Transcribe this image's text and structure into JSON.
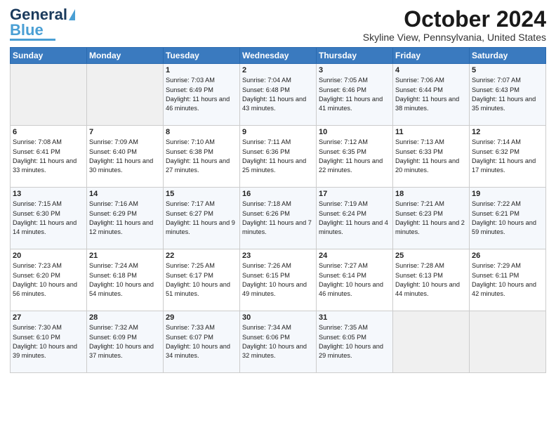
{
  "header": {
    "logo_line1": "General",
    "logo_line2": "Blue",
    "month": "October 2024",
    "location": "Skyline View, Pennsylvania, United States"
  },
  "weekdays": [
    "Sunday",
    "Monday",
    "Tuesday",
    "Wednesday",
    "Thursday",
    "Friday",
    "Saturday"
  ],
  "weeks": [
    [
      {
        "day": "",
        "sunrise": "",
        "sunset": "",
        "daylight": ""
      },
      {
        "day": "",
        "sunrise": "",
        "sunset": "",
        "daylight": ""
      },
      {
        "day": "1",
        "sunrise": "Sunrise: 7:03 AM",
        "sunset": "Sunset: 6:49 PM",
        "daylight": "Daylight: 11 hours and 46 minutes."
      },
      {
        "day": "2",
        "sunrise": "Sunrise: 7:04 AM",
        "sunset": "Sunset: 6:48 PM",
        "daylight": "Daylight: 11 hours and 43 minutes."
      },
      {
        "day": "3",
        "sunrise": "Sunrise: 7:05 AM",
        "sunset": "Sunset: 6:46 PM",
        "daylight": "Daylight: 11 hours and 41 minutes."
      },
      {
        "day": "4",
        "sunrise": "Sunrise: 7:06 AM",
        "sunset": "Sunset: 6:44 PM",
        "daylight": "Daylight: 11 hours and 38 minutes."
      },
      {
        "day": "5",
        "sunrise": "Sunrise: 7:07 AM",
        "sunset": "Sunset: 6:43 PM",
        "daylight": "Daylight: 11 hours and 35 minutes."
      }
    ],
    [
      {
        "day": "6",
        "sunrise": "Sunrise: 7:08 AM",
        "sunset": "Sunset: 6:41 PM",
        "daylight": "Daylight: 11 hours and 33 minutes."
      },
      {
        "day": "7",
        "sunrise": "Sunrise: 7:09 AM",
        "sunset": "Sunset: 6:40 PM",
        "daylight": "Daylight: 11 hours and 30 minutes."
      },
      {
        "day": "8",
        "sunrise": "Sunrise: 7:10 AM",
        "sunset": "Sunset: 6:38 PM",
        "daylight": "Daylight: 11 hours and 27 minutes."
      },
      {
        "day": "9",
        "sunrise": "Sunrise: 7:11 AM",
        "sunset": "Sunset: 6:36 PM",
        "daylight": "Daylight: 11 hours and 25 minutes."
      },
      {
        "day": "10",
        "sunrise": "Sunrise: 7:12 AM",
        "sunset": "Sunset: 6:35 PM",
        "daylight": "Daylight: 11 hours and 22 minutes."
      },
      {
        "day": "11",
        "sunrise": "Sunrise: 7:13 AM",
        "sunset": "Sunset: 6:33 PM",
        "daylight": "Daylight: 11 hours and 20 minutes."
      },
      {
        "day": "12",
        "sunrise": "Sunrise: 7:14 AM",
        "sunset": "Sunset: 6:32 PM",
        "daylight": "Daylight: 11 hours and 17 minutes."
      }
    ],
    [
      {
        "day": "13",
        "sunrise": "Sunrise: 7:15 AM",
        "sunset": "Sunset: 6:30 PM",
        "daylight": "Daylight: 11 hours and 14 minutes."
      },
      {
        "day": "14",
        "sunrise": "Sunrise: 7:16 AM",
        "sunset": "Sunset: 6:29 PM",
        "daylight": "Daylight: 11 hours and 12 minutes."
      },
      {
        "day": "15",
        "sunrise": "Sunrise: 7:17 AM",
        "sunset": "Sunset: 6:27 PM",
        "daylight": "Daylight: 11 hours and 9 minutes."
      },
      {
        "day": "16",
        "sunrise": "Sunrise: 7:18 AM",
        "sunset": "Sunset: 6:26 PM",
        "daylight": "Daylight: 11 hours and 7 minutes."
      },
      {
        "day": "17",
        "sunrise": "Sunrise: 7:19 AM",
        "sunset": "Sunset: 6:24 PM",
        "daylight": "Daylight: 11 hours and 4 minutes."
      },
      {
        "day": "18",
        "sunrise": "Sunrise: 7:21 AM",
        "sunset": "Sunset: 6:23 PM",
        "daylight": "Daylight: 11 hours and 2 minutes."
      },
      {
        "day": "19",
        "sunrise": "Sunrise: 7:22 AM",
        "sunset": "Sunset: 6:21 PM",
        "daylight": "Daylight: 10 hours and 59 minutes."
      }
    ],
    [
      {
        "day": "20",
        "sunrise": "Sunrise: 7:23 AM",
        "sunset": "Sunset: 6:20 PM",
        "daylight": "Daylight: 10 hours and 56 minutes."
      },
      {
        "day": "21",
        "sunrise": "Sunrise: 7:24 AM",
        "sunset": "Sunset: 6:18 PM",
        "daylight": "Daylight: 10 hours and 54 minutes."
      },
      {
        "day": "22",
        "sunrise": "Sunrise: 7:25 AM",
        "sunset": "Sunset: 6:17 PM",
        "daylight": "Daylight: 10 hours and 51 minutes."
      },
      {
        "day": "23",
        "sunrise": "Sunrise: 7:26 AM",
        "sunset": "Sunset: 6:15 PM",
        "daylight": "Daylight: 10 hours and 49 minutes."
      },
      {
        "day": "24",
        "sunrise": "Sunrise: 7:27 AM",
        "sunset": "Sunset: 6:14 PM",
        "daylight": "Daylight: 10 hours and 46 minutes."
      },
      {
        "day": "25",
        "sunrise": "Sunrise: 7:28 AM",
        "sunset": "Sunset: 6:13 PM",
        "daylight": "Daylight: 10 hours and 44 minutes."
      },
      {
        "day": "26",
        "sunrise": "Sunrise: 7:29 AM",
        "sunset": "Sunset: 6:11 PM",
        "daylight": "Daylight: 10 hours and 42 minutes."
      }
    ],
    [
      {
        "day": "27",
        "sunrise": "Sunrise: 7:30 AM",
        "sunset": "Sunset: 6:10 PM",
        "daylight": "Daylight: 10 hours and 39 minutes."
      },
      {
        "day": "28",
        "sunrise": "Sunrise: 7:32 AM",
        "sunset": "Sunset: 6:09 PM",
        "daylight": "Daylight: 10 hours and 37 minutes."
      },
      {
        "day": "29",
        "sunrise": "Sunrise: 7:33 AM",
        "sunset": "Sunset: 6:07 PM",
        "daylight": "Daylight: 10 hours and 34 minutes."
      },
      {
        "day": "30",
        "sunrise": "Sunrise: 7:34 AM",
        "sunset": "Sunset: 6:06 PM",
        "daylight": "Daylight: 10 hours and 32 minutes."
      },
      {
        "day": "31",
        "sunrise": "Sunrise: 7:35 AM",
        "sunset": "Sunset: 6:05 PM",
        "daylight": "Daylight: 10 hours and 29 minutes."
      },
      {
        "day": "",
        "sunrise": "",
        "sunset": "",
        "daylight": ""
      },
      {
        "day": "",
        "sunrise": "",
        "sunset": "",
        "daylight": ""
      }
    ]
  ]
}
